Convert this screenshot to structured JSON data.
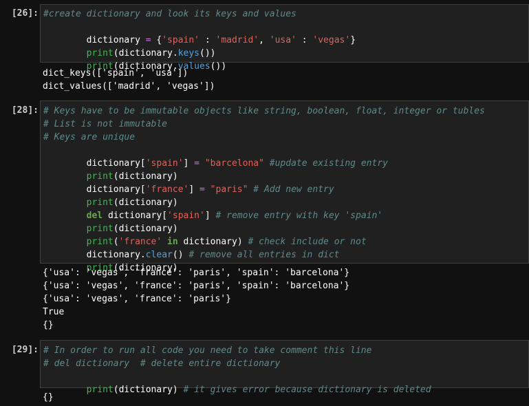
{
  "colors": {
    "background": "#111111",
    "input_bg": "#202020",
    "input_border": "#3f3f3f",
    "comment": "#5f8a8a",
    "builtin": "#3fb950",
    "method": "#4fa3e0",
    "string": "#e0635a",
    "operator": "#c678dd",
    "text": "#ffffff"
  },
  "cells": [
    {
      "prompt": "[26]:",
      "code": [
        "#create dictionary and look its keys and values",
        "dictionary = {'spain' : 'madrid', 'usa' : 'vegas'}",
        "print(dictionary.keys())",
        "print(dictionary.values())"
      ],
      "output": [
        "dict_keys(['spain', 'usa'])",
        "dict_values(['madrid', 'vegas'])"
      ]
    },
    {
      "prompt": "[28]:",
      "code": [
        "# Keys have to be immutable objects like string, boolean, float, integer or tubles",
        "# List is not immutable",
        "# Keys are unique",
        "dictionary['spain'] = \"barcelona\" #update existing entry",
        "print(dictionary)",
        "dictionary['france'] = \"paris\" # Add new entry",
        "print(dictionary)",
        "del dictionary['spain'] # remove entry with key 'spain'",
        "print(dictionary)",
        "print('france' in dictionary) # check include or not",
        "dictionary.clear() # remove all entries in dict",
        "print(dictionary)"
      ],
      "output": [
        "{'usa': 'vegas', 'france': 'paris', 'spain': 'barcelona'}",
        "{'usa': 'vegas', 'france': 'paris', 'spain': 'barcelona'}",
        "{'usa': 'vegas', 'france': 'paris'}",
        "True",
        "{}"
      ]
    },
    {
      "prompt": "[29]:",
      "code": [
        "# In order to run all code you need to take comment this line",
        "# del dictionary  # delete entire dictionary",
        "print(dictionary) # it gives error because dictionary is deleted"
      ],
      "output": [
        "{}"
      ]
    }
  ],
  "tokens": {
    "c26_l1": "dictionary",
    "c26_l1_eq": " = ",
    "c26_l1_a": "{",
    "c26_l1_s1": "'spain'",
    "c26_l1_c1": " : ",
    "c26_l1_s2": "'madrid'",
    "c26_l1_c2": ", ",
    "c26_l1_s3": "'usa'",
    "c26_l1_c3": " : ",
    "c26_l1_s4": "'vegas'",
    "c26_l1_e": "}",
    "print": "print",
    "lp": "(",
    "dictionary": "dictionary",
    "dot": ".",
    "keys": "keys",
    "values": "values",
    "close2": "())",
    "close1": ")",
    "lb": "[",
    "rb": "]",
    "eq": " = ",
    "spain_q": "'spain'",
    "france_q": "'france'",
    "barcelona_dq": "\"barcelona\"",
    "paris_dq": "\"paris\"",
    "update_cm": " #update existing entry",
    "add_cm": " # Add new entry",
    "del_kw": "del",
    "sp": " ",
    "remove_cm": " # remove entry with key 'spain'",
    "in_kw": " in ",
    "check_cm": " # check include or not",
    "clear": "clear",
    "clear_paren": "()",
    "clear_cm": " # remove all entries in dict",
    "error_cm": " # it gives error because dictionary is deleted"
  }
}
